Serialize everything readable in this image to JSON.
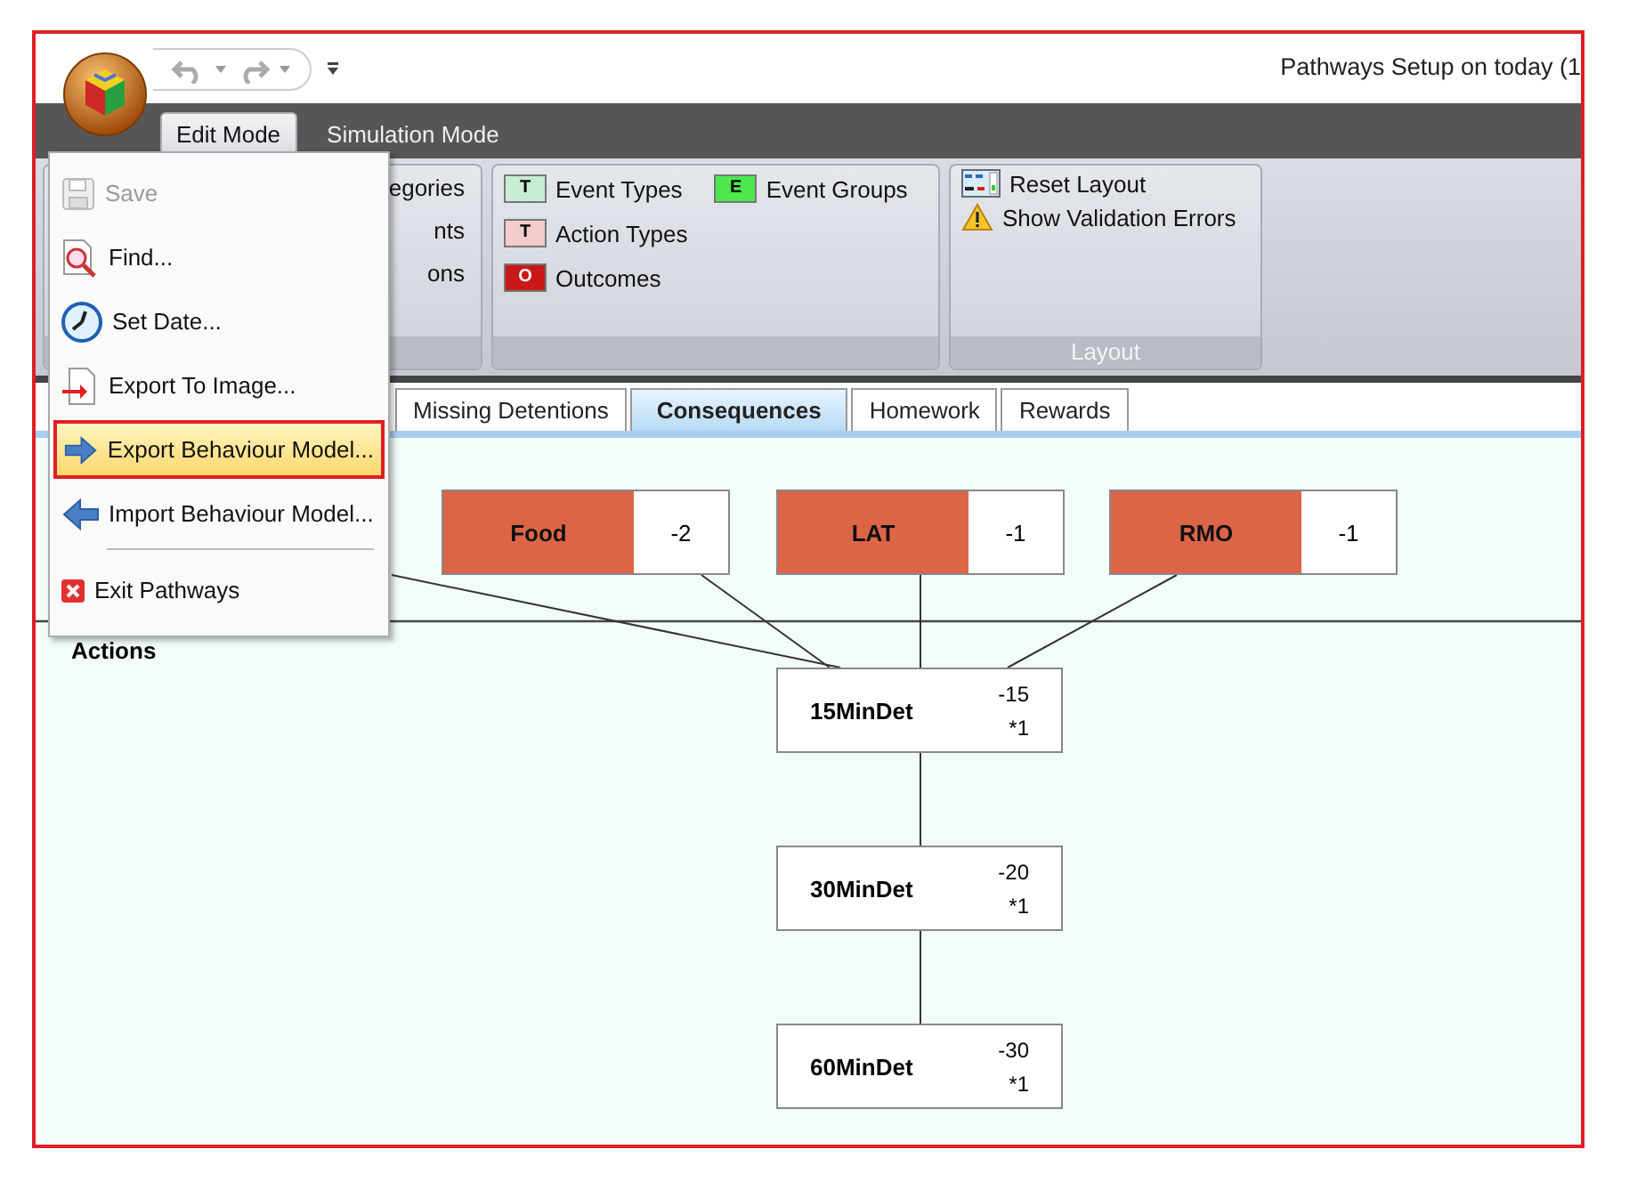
{
  "window": {
    "title": "Pathways Setup on today (1"
  },
  "ribbon_tabs": [
    {
      "label": "Edit Mode",
      "selected": true
    },
    {
      "label": "Simulation Mode",
      "selected": false
    }
  ],
  "ribbon_groups": [
    {
      "rows": [
        [
          {
            "label": "egories"
          }
        ],
        [
          {
            "label": "nts"
          }
        ],
        [
          {
            "label": "ons"
          }
        ]
      ]
    },
    {
      "rows": [
        [
          {
            "label": "Event Types",
            "badge": "T",
            "color": "#c8ecd4"
          },
          {
            "label": "Event Groups",
            "badge": "E",
            "color": "#4ce84c"
          }
        ],
        [
          {
            "label": "Action Types",
            "badge": "T",
            "color": "#f4cccc"
          }
        ],
        [
          {
            "label": "Outcomes",
            "badge": "O",
            "color": "#c81818"
          }
        ]
      ]
    },
    {
      "caption": "Layout",
      "rows": [
        [
          {
            "label": "Reset Layout",
            "kind": "layout"
          }
        ],
        [
          {
            "label": "Show Validation Errors",
            "kind": "warning"
          }
        ]
      ]
    }
  ],
  "app_menu": [
    {
      "kind": "save",
      "label": "Save",
      "disabled": true,
      "selected": false
    },
    {
      "kind": "find",
      "label": "Find...",
      "disabled": false,
      "selected": false
    },
    {
      "kind": "date",
      "label": "Set Date...",
      "disabled": false,
      "selected": false
    },
    {
      "kind": "image",
      "label": "Export To Image...",
      "disabled": false,
      "selected": false
    },
    {
      "kind": "export",
      "label": "Export Behaviour Model...",
      "disabled": false,
      "selected": true
    },
    {
      "kind": "import",
      "label": "Import Behaviour Model...",
      "disabled": false,
      "selected": false
    },
    {
      "kind": "separator"
    },
    {
      "kind": "exit",
      "label": "Exit Pathways",
      "disabled": false,
      "selected": false
    }
  ],
  "document_tabs": [
    {
      "label": "Missing Detentions",
      "selected": false
    },
    {
      "label": "Consequences",
      "selected": true
    },
    {
      "label": "Homework",
      "selected": false
    },
    {
      "label": "Rewards",
      "selected": false
    }
  ],
  "diagram": {
    "section_label": "Actions",
    "behaviours": [
      {
        "name": "Food",
        "value": "-2"
      },
      {
        "name": "LAT",
        "value": "-1"
      },
      {
        "name": "RMO",
        "value": "-1"
      }
    ],
    "actions": [
      {
        "name": "15MinDet",
        "value": "-15",
        "multiplier": "*1"
      },
      {
        "name": "30MinDet",
        "value": "-20",
        "multiplier": "*1"
      },
      {
        "name": "60MinDet",
        "value": "-30",
        "multiplier": "*1"
      }
    ]
  }
}
